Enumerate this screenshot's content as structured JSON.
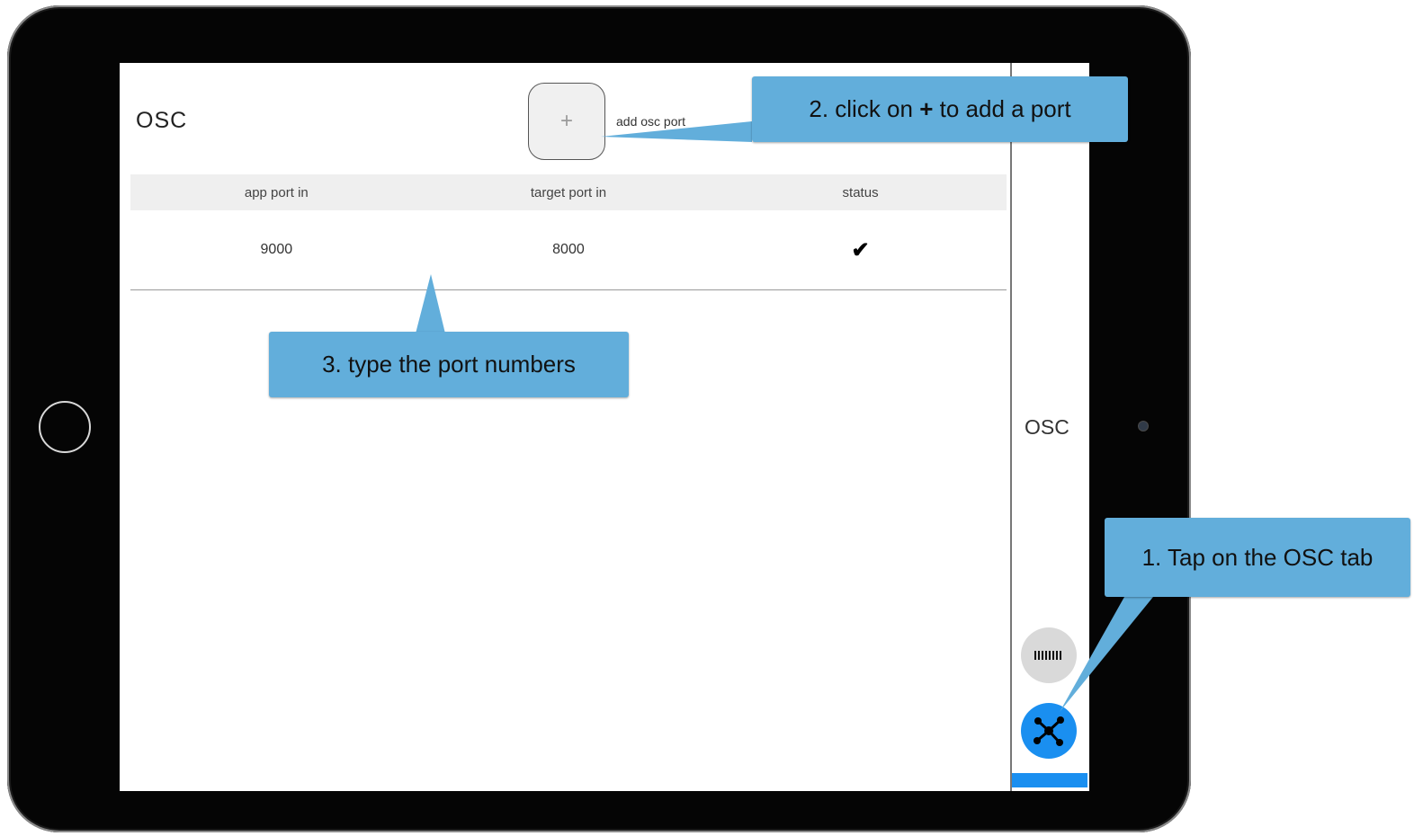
{
  "screen": {
    "title": "OSC",
    "add_button": {
      "icon": "plus-icon",
      "symbol": "+",
      "label": "add osc port"
    },
    "table": {
      "columns": [
        "app port in",
        "target port in",
        "status"
      ],
      "rows": [
        {
          "app_port_in": "9000",
          "target_port_in": "8000",
          "status": "ok",
          "status_icon": "checkmark-icon",
          "status_symbol": "✔"
        }
      ]
    },
    "sidebar": {
      "tab_label": "OSC",
      "tabs": [
        {
          "icon": "barcode-icon",
          "active": false
        },
        {
          "icon": "network-node-icon",
          "active": true
        }
      ]
    }
  },
  "callouts": {
    "step1": "1. Tap on the OSC tab",
    "step2_prefix": "2. click on ",
    "step2_plus": "+",
    "step2_suffix": " to add a port",
    "step3": "3. type the port numbers"
  },
  "colors": {
    "callout": "#62aedb",
    "accent": "#1a8ff0",
    "header_bg": "#efefef",
    "device": "#050505"
  }
}
